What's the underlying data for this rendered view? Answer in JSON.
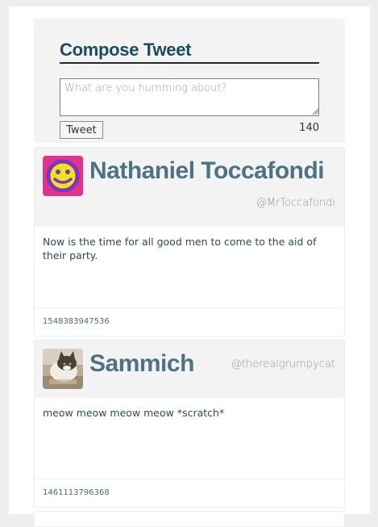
{
  "compose": {
    "title": "Compose Tweet",
    "placeholder": "What are you humming about?",
    "value": "",
    "button_label": "Tweet",
    "char_count": "140"
  },
  "tweets": [
    {
      "name": "Nathaniel Toccafondi",
      "handle": "@MrToccafondi",
      "text": "Now is the time for all good men to come to the aid of their party.",
      "timestamp": "1548383947536",
      "avatar": "smiley-face-icon"
    },
    {
      "name": "Sammich",
      "handle": "@therealgrumpycat",
      "text": "meow meow meow meow *scratch*",
      "timestamp": "1461113796368",
      "avatar": "cat-photo"
    }
  ],
  "colors": {
    "title": "#1c4a5e",
    "name": "#4d7380",
    "panel": "#f3f3f3",
    "avatar_bg": "#e0338a",
    "avatar_face": "#7b35c2"
  }
}
